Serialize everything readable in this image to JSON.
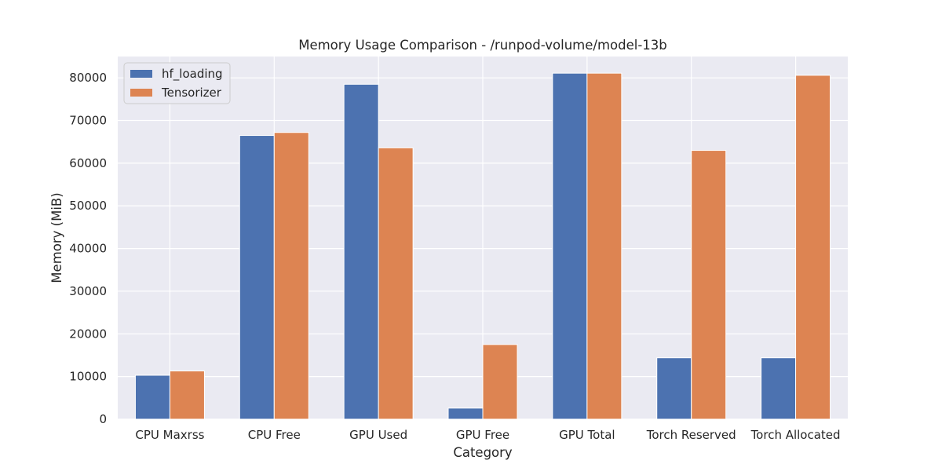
{
  "chart_data": {
    "type": "bar",
    "title": "Memory Usage Comparison - /runpod-volume/model-13b",
    "xlabel": "Category",
    "ylabel": "Memory (MiB)",
    "categories": [
      "CPU Maxrss",
      "CPU Free",
      "GPU Used",
      "GPU Free",
      "GPU Total",
      "Torch Reserved",
      "Torch Allocated"
    ],
    "series": [
      {
        "name": "hf_loading",
        "color": "#4c72b0",
        "values": [
          10300,
          66500,
          78500,
          2600,
          81100,
          14400,
          14400
        ]
      },
      {
        "name": "Tensorizer",
        "color": "#dd8452",
        "values": [
          11300,
          67200,
          63600,
          17500,
          81100,
          63000,
          80600
        ]
      }
    ],
    "ylim": [
      0,
      85000
    ],
    "yticks": [
      0,
      10000,
      20000,
      30000,
      40000,
      50000,
      60000,
      70000,
      80000
    ],
    "grid": true,
    "legend_position": "top-left",
    "background_color": "#eaeaf2",
    "grid_color": "#ffffff"
  }
}
